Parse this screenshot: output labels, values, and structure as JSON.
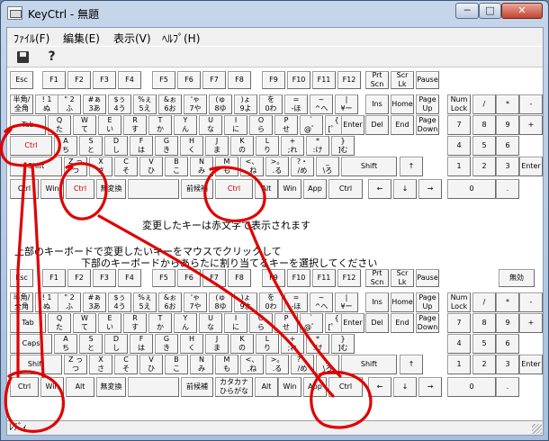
{
  "window": {
    "title": "KeyCtrl - 無題",
    "minimize": "─",
    "maximize": "□",
    "close": "✕"
  },
  "menu": [
    "ﾌｧｲﾙ(F)",
    "編集(E)",
    "表示(V)",
    "ﾍﾙﾌﾟ(H)"
  ],
  "toolbar": {
    "save_icon": "floppy-disk-icon",
    "help_icon": "help-arrow-icon",
    "help_glyph": "?"
  },
  "messages": {
    "changed_note": "変更したキーは赤文字で表示されます",
    "instruction_1": "上部のキーボードで変更したいキーをマウスでクリックして",
    "instruction_2": "下部のキーボードからあらたに割り当てるキーを選択してください"
  },
  "status": "ﾚﾃﾞｨ",
  "colors": {
    "changed_key": "#cc0000",
    "annotation": "#e00000"
  },
  "top_keyboard": {
    "fn_row": [
      "Esc",
      "F1",
      "F2",
      "F3",
      "F4",
      "F5",
      "F6",
      "F7",
      "F8",
      "F9",
      "F10",
      "F11",
      "F12",
      "Prt\nScn",
      "Scr\nLk",
      "Pause"
    ],
    "num_row": [
      "半角/\n全角",
      "! 1\nぬ",
      "\" 2\nふ",
      "#ぁ\n3あ",
      "$ぅ\n4う",
      "%ぇ\n5え",
      "&ぉ\n6お",
      "'ゃ\n7や",
      "(ゅ\n8ゆ",
      ")ょ\n9よ",
      "を\n0わ",
      "=\n-ほ",
      "~\n^へ",
      "|\n¥ー",
      "BS",
      "Ins",
      "Home",
      "Page\nUp",
      "Num\nLock",
      "/",
      "*",
      "-"
    ],
    "tab_row": [
      "Tab",
      "Q\nた",
      "W\nて",
      "E\nい",
      "R\nす",
      "T\nか",
      "Y\nん",
      "U\nな",
      "I\nに",
      "O\nら",
      "P\nせ",
      "`\n@゛",
      "{\n[゜「",
      "Enter",
      "Del",
      "End",
      "Page\nDown",
      "7",
      "8",
      "9",
      "+"
    ],
    "caps_row": [
      "Ctrl",
      "A\nち",
      "S\nと",
      "D\nし",
      "F\nは",
      "G\nき",
      "H\nく",
      "J\nま",
      "K\nの",
      "L\nり",
      "+\n;れ",
      "*\n:け",
      "}\n]む",
      "4",
      "5",
      "6"
    ],
    "shift_row": [
      "Shift",
      "Z っ\nつ",
      "X\nさ",
      "C\nそ",
      "V\nひ",
      "B\nこ",
      "N\nみ",
      "M\nも",
      "<、\n,ね",
      ">。\n.る",
      "?・\n/め",
      "_\n\\ろ",
      "Shift",
      "↑",
      "1",
      "2",
      "3",
      "Enter"
    ],
    "bottom_row": [
      "Ctrl",
      "Win",
      "Ctrl",
      "無変換",
      "",
      "前候補",
      "Ctrl",
      "Alt",
      "Win",
      "App",
      "Ctrl",
      "←",
      "↓",
      "→",
      "0",
      "."
    ]
  },
  "bottom_keyboard": {
    "fn_row": [
      "Esc",
      "F1",
      "F2",
      "F3",
      "F4",
      "F5",
      "F6",
      "F7",
      "F8",
      "F9",
      "F10",
      "F11",
      "F12",
      "Prt\nScn",
      "Scr\nLk",
      "Pause",
      "無効"
    ],
    "num_row": [
      "半角/\n全角",
      "! 1\nぬ",
      "\" 2\nふ",
      "#ぁ\n3あ",
      "$ぅ\n4う",
      "%ぇ\n5え",
      "&ぉ\n6お",
      "'ゃ\n7や",
      "(ゅ\n8ゆ",
      ")ょ\n9よ",
      "を\n0わ",
      "=\n-ほ",
      "~\n^へ",
      "|\n¥ー",
      "BS",
      "Ins",
      "Home",
      "Page\nUp",
      "Num\nLock",
      "/",
      "*",
      "-"
    ],
    "tab_row": [
      "Tab",
      "Q\nた",
      "W\nて",
      "E\nい",
      "R\nす",
      "T\nか",
      "Y\nん",
      "U\nな",
      "I\nに",
      "O\nら",
      "P\nせ",
      "`\n@゛",
      "{\n[゜「",
      "Enter",
      "Del",
      "End",
      "Page\nDown",
      "7",
      "8",
      "9",
      "+"
    ],
    "caps_row": [
      "Caps",
      "A\nち",
      "S\nと",
      "D\nし",
      "F\nは",
      "G\nき",
      "H\nく",
      "J\nま",
      "K\nの",
      "L\nり",
      "+\n;れ",
      "*\n:け",
      "}\n]む",
      "4",
      "5",
      "6"
    ],
    "shift_row": [
      "Shift",
      "Z っ\nつ",
      "X\nさ",
      "C\nそ",
      "V\nひ",
      "B\nこ",
      "N\nみ",
      "M\nも",
      "<、\n,ね",
      ">。\n.る",
      "?・\n/め",
      "_\n\\ろ",
      "Shift",
      "↑",
      "1",
      "2",
      "3",
      "Enter"
    ],
    "bottom_row": [
      "Ctrl",
      "Win",
      "Alt",
      "無変換",
      "",
      "前候補",
      "カタカナ\nひらがな",
      "Alt",
      "Win",
      "App",
      "Ctrl",
      "←",
      "↓",
      "→",
      "0",
      "."
    ]
  }
}
